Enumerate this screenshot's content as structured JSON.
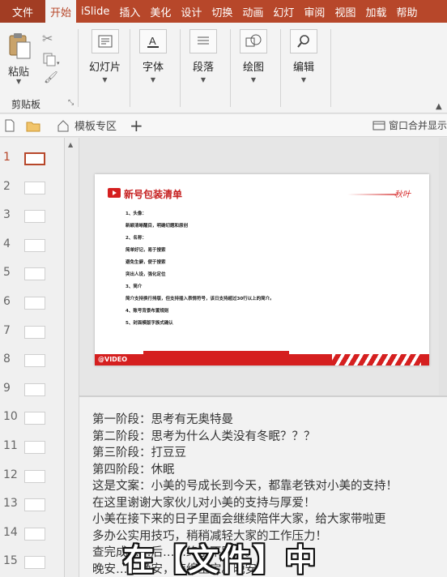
{
  "tabs": [
    "文件",
    "开始",
    "iSlide",
    "插入",
    "美化",
    "设计",
    "切换",
    "动画",
    "幻灯",
    "审阅",
    "视图",
    "加载",
    "帮助"
  ],
  "active_tab_index": 1,
  "ribbon": {
    "clipboard": {
      "paste": "粘贴",
      "group_label": "剪贴板"
    },
    "buttons": [
      "幻灯片",
      "字体",
      "段落",
      "绘图",
      "编辑"
    ]
  },
  "docbar": {
    "template_zone": "模板专区",
    "add": "+",
    "window_merge": "窗口合并显示"
  },
  "thumbnails": [
    "1",
    "2",
    "3",
    "4",
    "5",
    "6",
    "7",
    "8",
    "9",
    "10",
    "11",
    "12",
    "13",
    "14",
    "15"
  ],
  "selected_slide": 1,
  "slide": {
    "title": "新号包装清单",
    "brand": "秋叶",
    "footer_label": "@VIDEO",
    "lines": [
      "1、头像：",
      "新颖清晰醒目，明确切题和原创",
      "2、名称：",
      "简单好记，易于搜索",
      "避免生僻，便于搜索",
      "突出人设，强化定位",
      "3、简介",
      "简介支持换行排版，但支持插入表情符号，该日支持超过30行以上的简介。",
      "4、账号背景布置规则",
      "5、封面模版字族式确认"
    ]
  },
  "notes": [
    "第一阶段：思考有无奥特曼",
    "第二阶段：思考为什么人类没有冬眠？？？",
    "第三阶段：打豆豆",
    "第四阶段：休眠",
    "这是文案：小美的号成长到今天，都靠老铁对小美的支持！",
    "在这里谢谢大家伙儿对小美的支持与厚爱！",
    "小美在接下来的日子里面会继续陪伴大家，给大家带啦更",
    "多办公实用技巧，稍稍减轻大家的工作压力！",
    "查完成……后……终于不跳了。",
    "晚安……晚安，海绵宝宝。晚安，"
  ],
  "caption": "在【文件】中"
}
